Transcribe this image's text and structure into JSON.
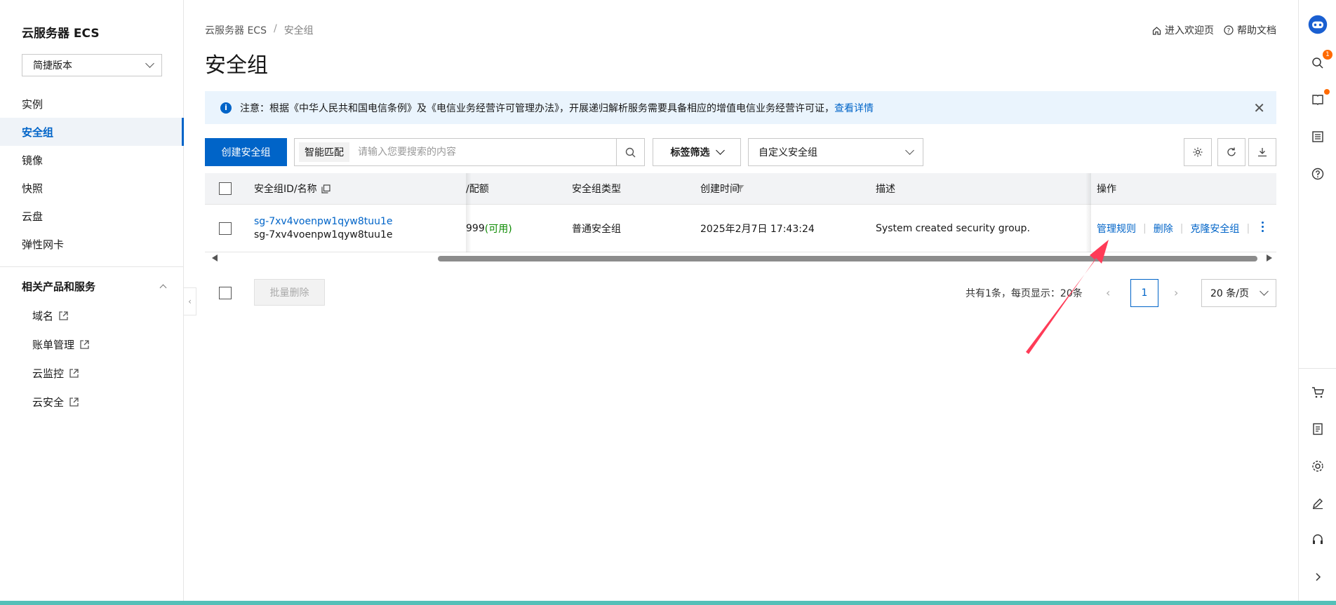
{
  "sidebar": {
    "title": "云服务器 ECS",
    "version_select": "简捷版本",
    "items": [
      {
        "label": "实例"
      },
      {
        "label": "安全组"
      },
      {
        "label": "镜像"
      },
      {
        "label": "快照"
      },
      {
        "label": "云盘"
      },
      {
        "label": "弹性网卡"
      }
    ],
    "section_title": "相关产品和服务",
    "sub_items": [
      {
        "label": "域名"
      },
      {
        "label": "账单管理"
      },
      {
        "label": "云监控"
      },
      {
        "label": "云安全"
      }
    ]
  },
  "header": {
    "breadcrumb": [
      "云服务器 ECS",
      "安全组"
    ],
    "breadcrumb_sep": "/",
    "links": [
      "进入欢迎页",
      "帮助文档"
    ],
    "title": "安全组"
  },
  "notice": {
    "text": "注意：根据《中华人民共和国电信条例》及《电信业务经营许可管理办法》，开展递归解析服务需要具备相应的增值电信业务经营许可证，",
    "link": "查看详情"
  },
  "toolbar": {
    "create_label": "创建安全组",
    "search_tag": "智能匹配",
    "search_placeholder": "请输入您要搜索的内容",
    "tag_filter": "标签筛选",
    "custom_select": "自定义安全组"
  },
  "table": {
    "columns": [
      "安全组ID/名称",
      "/配额",
      "安全组类型",
      "创建时间",
      "描述",
      "操作"
    ],
    "rows": [
      {
        "id": "sg-7xv4voenpw1qyw8tuu1e",
        "name": "sg-7xv4voenpw1qyw8tuu1e",
        "quota": "999",
        "quota_status": "(可用)",
        "type": "普通安全组",
        "created": "2025年2月7日 17:43:24",
        "description": "System created security group.",
        "actions": [
          "管理规则",
          "删除",
          "克隆安全组"
        ]
      }
    ]
  },
  "footer": {
    "batch_delete": "批量删除",
    "total_text": "共有1条，每页显示：20条",
    "current_page": "1",
    "page_size": "20 条/页"
  },
  "rail": {
    "badge_count": "1"
  },
  "colors": {
    "accent": "#0064c8",
    "notice_bg": "#eaf4fd",
    "available": "#0b8a00",
    "annotation_arrow": "#ff3b57"
  }
}
